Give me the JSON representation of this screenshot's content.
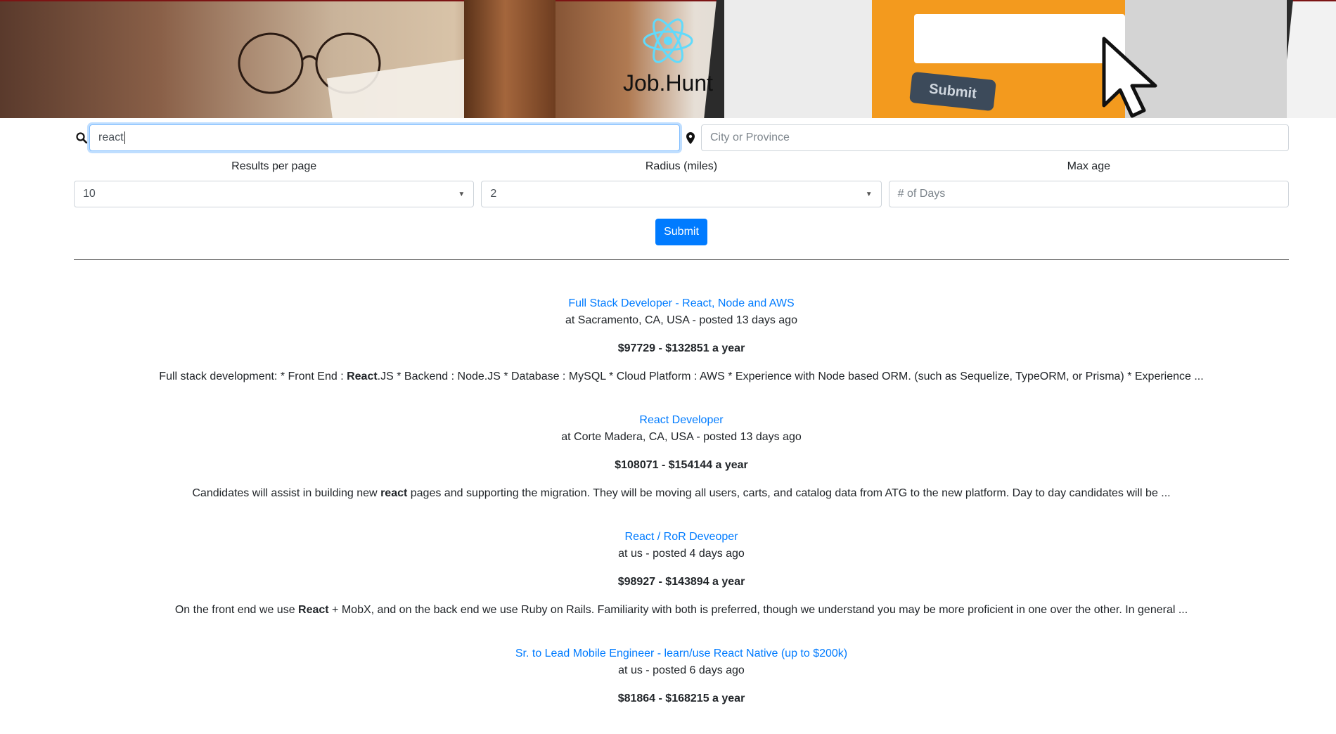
{
  "brand": {
    "name": "Job.Hunt",
    "accent": "#61dafb"
  },
  "hero": {
    "submit_label": "Submit"
  },
  "search": {
    "query_value": "react",
    "location_placeholder": "City or Province",
    "query_icon": "search-icon",
    "location_icon": "map-marker-icon"
  },
  "filters": {
    "results_per_page_label": "Results per page",
    "results_per_page_value": "10",
    "radius_label": "Radius (miles)",
    "radius_value": "2",
    "max_age_label": "Max age",
    "max_age_placeholder": "# of Days"
  },
  "submit_label": "Submit",
  "colors": {
    "primary": "#007bff",
    "text": "#212529",
    "border": "#ced4da"
  },
  "jobs": [
    {
      "title": "Full Stack Developer - React, Node and AWS",
      "location_line": "at Sacramento, CA, USA - posted 13 days ago",
      "salary": "$97729 - $132851 a year",
      "desc_before": "Full stack development: * Front End : ",
      "desc_bold": "React",
      "desc_after": ".JS * Backend : Node.JS * Database : MySQL * Cloud Platform : AWS * Experience with Node based ORM. (such as Sequelize, TypeORM, or Prisma) * Experience ..."
    },
    {
      "title": "React Developer",
      "location_line": "at Corte Madera, CA, USA - posted 13 days ago",
      "salary": "$108071 - $154144 a year",
      "desc_before": "Candidates will assist in building new ",
      "desc_bold": "react",
      "desc_after": " pages and supporting the migration. They will be moving all users, carts, and catalog data from ATG to the new platform. Day to day candidates will be ..."
    },
    {
      "title": "React / RoR Deveoper",
      "location_line": "at us - posted 4 days ago",
      "salary": "$98927 - $143894 a year",
      "desc_before": "On the front end we use ",
      "desc_bold": "React",
      "desc_after": " + MobX, and on the back end we use Ruby on Rails. Familiarity with both is preferred, though we understand you may be more proficient in one over the other. In general ..."
    },
    {
      "title": "Sr. to Lead Mobile Engineer - learn/use React Native (up to $200k)",
      "location_line": "at us - posted 6 days ago",
      "salary": "$81864 - $168215 a year",
      "desc_before": "",
      "desc_bold": "",
      "desc_after": ""
    }
  ]
}
